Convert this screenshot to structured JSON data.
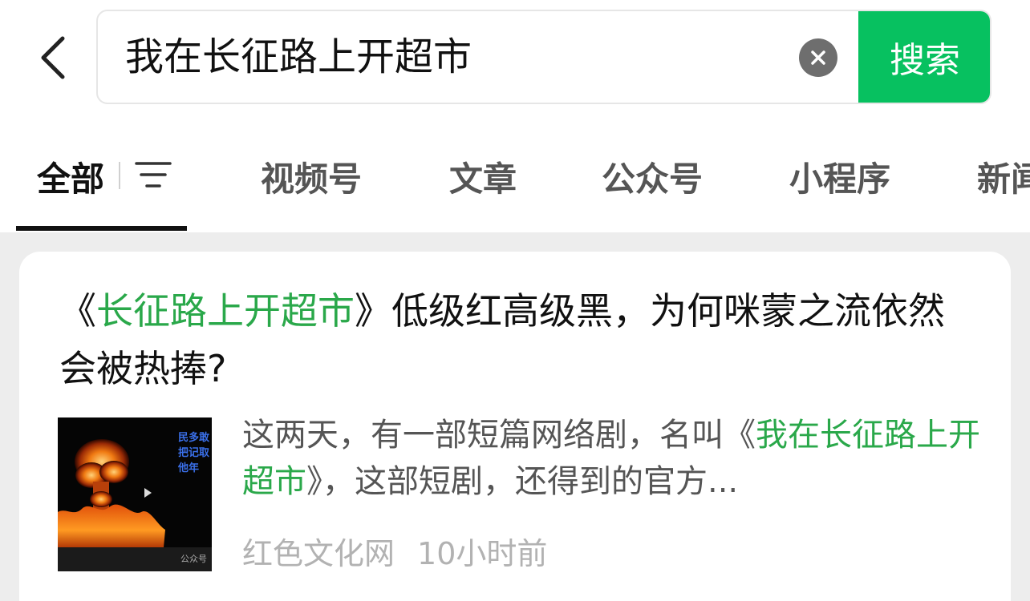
{
  "search": {
    "query": "我在长征路上开超市",
    "button_label": "搜索"
  },
  "tabs": [
    {
      "label": "全部",
      "active": true
    },
    {
      "label": "视频号"
    },
    {
      "label": "文章"
    },
    {
      "label": "公众号"
    },
    {
      "label": "小程序"
    },
    {
      "label": "新闻"
    }
  ],
  "result": {
    "title_open": "《",
    "title_highlight": "长征路上开超市",
    "title_rest": "》低级红高级黑，为何咪蒙之流依然会被热捧?",
    "snippet_pre": "这两天，有一部短篇网络剧，名叫《",
    "snippet_highlight": "我在长征路上开超市",
    "snippet_post": "》，这部短剧，还得到的官方...",
    "source": "红色文化网",
    "time": "10小时前",
    "thumbnail": {
      "overlay_text": "民多敢把记取他年",
      "watermark": "公众号"
    }
  },
  "colors": {
    "accent": "#07c160",
    "highlight": "#2aa84a",
    "background": "#ededed"
  },
  "icons": [
    "back-arrow-icon",
    "clear-icon",
    "filter-icon"
  ]
}
